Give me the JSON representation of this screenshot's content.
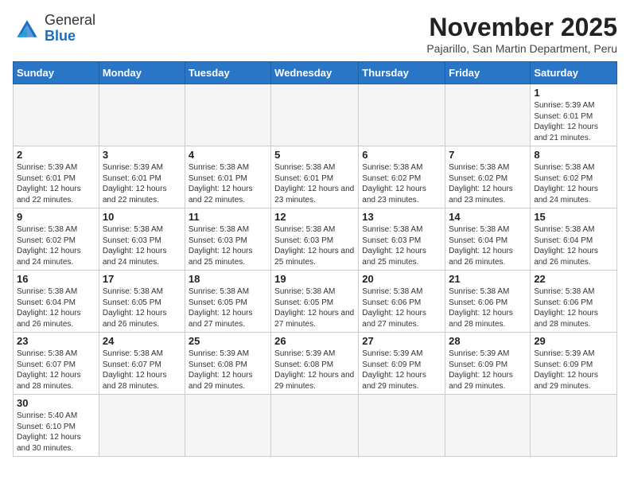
{
  "header": {
    "logo_general": "General",
    "logo_blue": "Blue",
    "month_title": "November 2025",
    "location": "Pajarillo, San Martin Department, Peru"
  },
  "days_of_week": [
    "Sunday",
    "Monday",
    "Tuesday",
    "Wednesday",
    "Thursday",
    "Friday",
    "Saturday"
  ],
  "weeks": [
    [
      {
        "day": "",
        "info": ""
      },
      {
        "day": "",
        "info": ""
      },
      {
        "day": "",
        "info": ""
      },
      {
        "day": "",
        "info": ""
      },
      {
        "day": "",
        "info": ""
      },
      {
        "day": "",
        "info": ""
      },
      {
        "day": "1",
        "info": "Sunrise: 5:39 AM\nSunset: 6:01 PM\nDaylight: 12 hours and 21 minutes."
      }
    ],
    [
      {
        "day": "2",
        "info": "Sunrise: 5:39 AM\nSunset: 6:01 PM\nDaylight: 12 hours and 22 minutes."
      },
      {
        "day": "3",
        "info": "Sunrise: 5:39 AM\nSunset: 6:01 PM\nDaylight: 12 hours and 22 minutes."
      },
      {
        "day": "4",
        "info": "Sunrise: 5:38 AM\nSunset: 6:01 PM\nDaylight: 12 hours and 22 minutes."
      },
      {
        "day": "5",
        "info": "Sunrise: 5:38 AM\nSunset: 6:01 PM\nDaylight: 12 hours and 23 minutes."
      },
      {
        "day": "6",
        "info": "Sunrise: 5:38 AM\nSunset: 6:02 PM\nDaylight: 12 hours and 23 minutes."
      },
      {
        "day": "7",
        "info": "Sunrise: 5:38 AM\nSunset: 6:02 PM\nDaylight: 12 hours and 23 minutes."
      },
      {
        "day": "8",
        "info": "Sunrise: 5:38 AM\nSunset: 6:02 PM\nDaylight: 12 hours and 24 minutes."
      }
    ],
    [
      {
        "day": "9",
        "info": "Sunrise: 5:38 AM\nSunset: 6:02 PM\nDaylight: 12 hours and 24 minutes."
      },
      {
        "day": "10",
        "info": "Sunrise: 5:38 AM\nSunset: 6:03 PM\nDaylight: 12 hours and 24 minutes."
      },
      {
        "day": "11",
        "info": "Sunrise: 5:38 AM\nSunset: 6:03 PM\nDaylight: 12 hours and 25 minutes."
      },
      {
        "day": "12",
        "info": "Sunrise: 5:38 AM\nSunset: 6:03 PM\nDaylight: 12 hours and 25 minutes."
      },
      {
        "day": "13",
        "info": "Sunrise: 5:38 AM\nSunset: 6:03 PM\nDaylight: 12 hours and 25 minutes."
      },
      {
        "day": "14",
        "info": "Sunrise: 5:38 AM\nSunset: 6:04 PM\nDaylight: 12 hours and 26 minutes."
      },
      {
        "day": "15",
        "info": "Sunrise: 5:38 AM\nSunset: 6:04 PM\nDaylight: 12 hours and 26 minutes."
      }
    ],
    [
      {
        "day": "16",
        "info": "Sunrise: 5:38 AM\nSunset: 6:04 PM\nDaylight: 12 hours and 26 minutes."
      },
      {
        "day": "17",
        "info": "Sunrise: 5:38 AM\nSunset: 6:05 PM\nDaylight: 12 hours and 26 minutes."
      },
      {
        "day": "18",
        "info": "Sunrise: 5:38 AM\nSunset: 6:05 PM\nDaylight: 12 hours and 27 minutes."
      },
      {
        "day": "19",
        "info": "Sunrise: 5:38 AM\nSunset: 6:05 PM\nDaylight: 12 hours and 27 minutes."
      },
      {
        "day": "20",
        "info": "Sunrise: 5:38 AM\nSunset: 6:06 PM\nDaylight: 12 hours and 27 minutes."
      },
      {
        "day": "21",
        "info": "Sunrise: 5:38 AM\nSunset: 6:06 PM\nDaylight: 12 hours and 28 minutes."
      },
      {
        "day": "22",
        "info": "Sunrise: 5:38 AM\nSunset: 6:06 PM\nDaylight: 12 hours and 28 minutes."
      }
    ],
    [
      {
        "day": "23",
        "info": "Sunrise: 5:38 AM\nSunset: 6:07 PM\nDaylight: 12 hours and 28 minutes."
      },
      {
        "day": "24",
        "info": "Sunrise: 5:38 AM\nSunset: 6:07 PM\nDaylight: 12 hours and 28 minutes."
      },
      {
        "day": "25",
        "info": "Sunrise: 5:39 AM\nSunset: 6:08 PM\nDaylight: 12 hours and 29 minutes."
      },
      {
        "day": "26",
        "info": "Sunrise: 5:39 AM\nSunset: 6:08 PM\nDaylight: 12 hours and 29 minutes."
      },
      {
        "day": "27",
        "info": "Sunrise: 5:39 AM\nSunset: 6:09 PM\nDaylight: 12 hours and 29 minutes."
      },
      {
        "day": "28",
        "info": "Sunrise: 5:39 AM\nSunset: 6:09 PM\nDaylight: 12 hours and 29 minutes."
      },
      {
        "day": "29",
        "info": "Sunrise: 5:39 AM\nSunset: 6:09 PM\nDaylight: 12 hours and 29 minutes."
      }
    ],
    [
      {
        "day": "30",
        "info": "Sunrise: 5:40 AM\nSunset: 6:10 PM\nDaylight: 12 hours and 30 minutes."
      },
      {
        "day": "",
        "info": ""
      },
      {
        "day": "",
        "info": ""
      },
      {
        "day": "",
        "info": ""
      },
      {
        "day": "",
        "info": ""
      },
      {
        "day": "",
        "info": ""
      },
      {
        "day": "",
        "info": ""
      }
    ]
  ]
}
